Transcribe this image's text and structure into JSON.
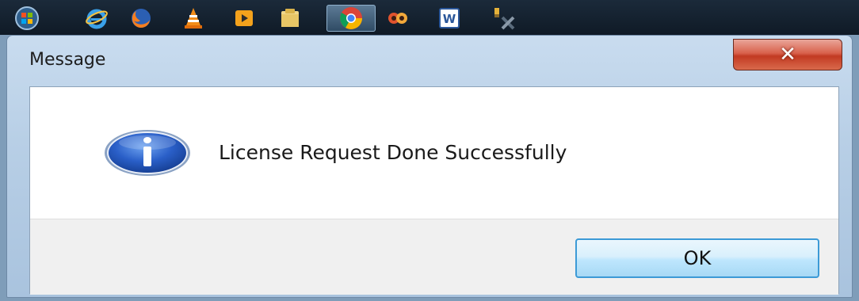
{
  "taskbar": {
    "items": [
      {
        "icon": "windows-start-icon",
        "active": false
      },
      {
        "icon": "internet-explorer-icon",
        "active": false
      },
      {
        "icon": "firefox-icon",
        "active": false
      },
      {
        "icon": "vlc-icon",
        "active": false
      },
      {
        "icon": "media-player-icon",
        "active": false
      },
      {
        "icon": "file-explorer-icon",
        "active": false
      },
      {
        "icon": "chrome-icon",
        "active": true
      },
      {
        "icon": "photos-icon",
        "active": false
      },
      {
        "icon": "word-icon",
        "active": false
      },
      {
        "icon": "tools-icon",
        "active": false
      }
    ]
  },
  "dialog": {
    "title": "Message",
    "close_label": "✕",
    "icon": "info-icon",
    "message": "License Request Done Successfully",
    "ok_label": "OK"
  },
  "colors": {
    "accent": "#3c9ad6",
    "close": "#c23a22",
    "info_blue": "#1f4fb8"
  }
}
